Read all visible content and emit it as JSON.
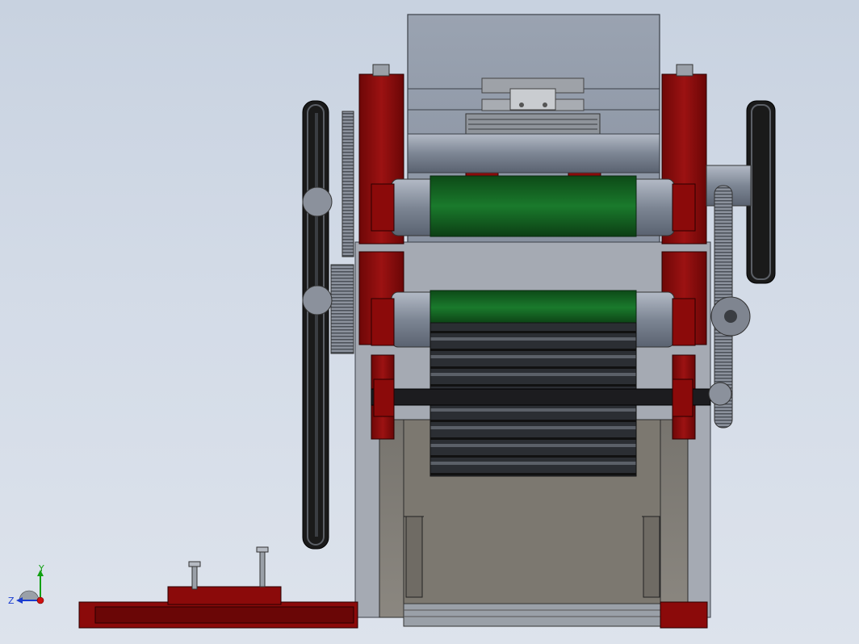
{
  "app": {
    "view": "Front"
  },
  "triad": {
    "x_label": "",
    "y_label": "Y",
    "z_label": "Z",
    "colors": {
      "x": "#d01010",
      "y": "#10a010",
      "z": "#1a3cd0"
    }
  },
  "palette": {
    "frame_red": "#8b0a0a",
    "belt_green": "#0f5a1e",
    "steel": "#8e97a6",
    "dark": "#1a1a1a"
  }
}
